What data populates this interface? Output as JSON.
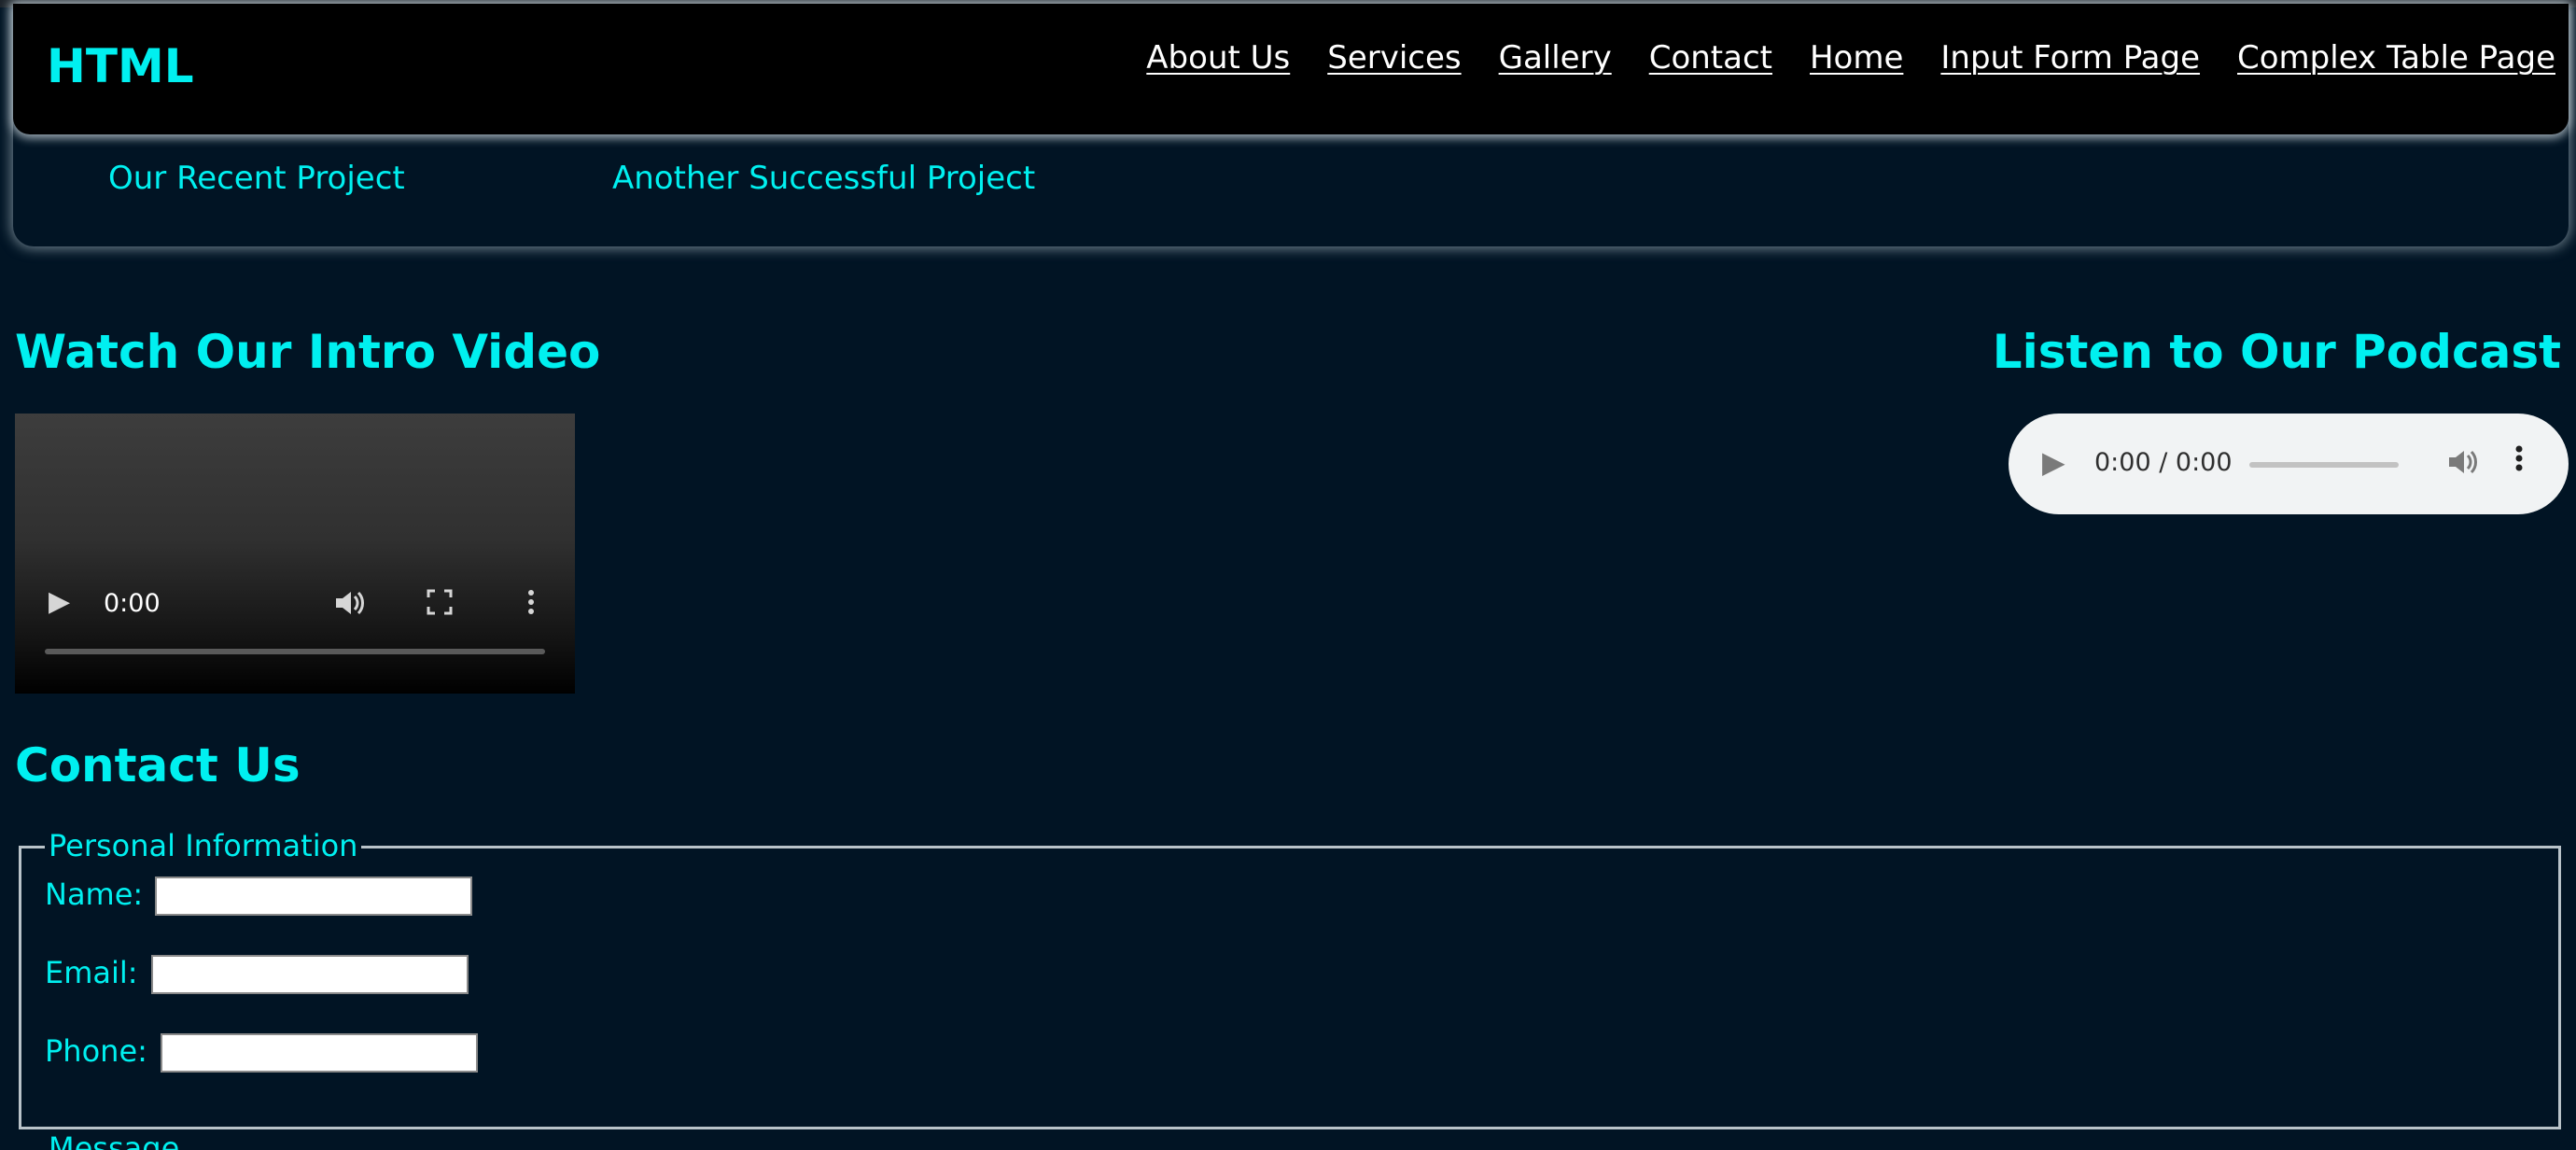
{
  "header": {
    "brand": "HTML",
    "nav": [
      "About Us",
      "Services",
      "Gallery",
      "Contact",
      "Home",
      "Input Form Page",
      "Complex Table Page"
    ]
  },
  "subnav": {
    "items": [
      "Our Recent Project",
      "Another Successful Project"
    ]
  },
  "video_section": {
    "title": "Watch Our Intro Video",
    "time": "0:00",
    "icons": [
      "play-icon",
      "volume-icon",
      "fullscreen-icon",
      "more-options-icon"
    ]
  },
  "podcast_section": {
    "title": "Listen to Our Podcast",
    "time": "0:00 / 0:00",
    "icons": [
      "play-icon",
      "volume-icon",
      "more-options-icon"
    ]
  },
  "contact": {
    "title": "Contact Us",
    "personal_legend": "Personal Information",
    "fields": {
      "name_label": "Name:",
      "email_label": "Email:",
      "phone_label": "Phone:",
      "name_value": "",
      "email_value": "",
      "phone_value": ""
    },
    "message_legend": "Message"
  },
  "colors": {
    "background": "#011424",
    "accent": "#00f0f0",
    "header_bar": "#000000",
    "nav_link": "#ffffff"
  }
}
